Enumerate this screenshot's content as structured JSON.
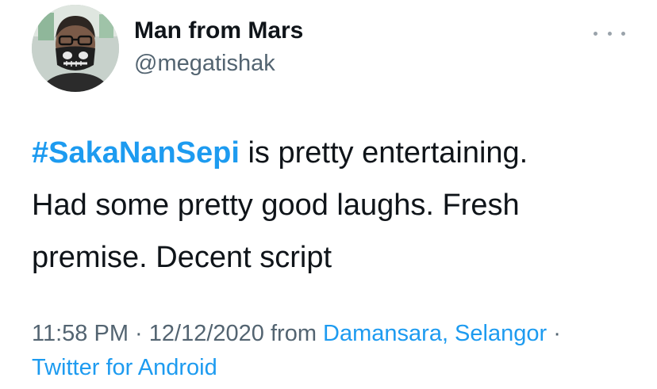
{
  "author": {
    "display_name": "Man from Mars",
    "handle": "@megatishak"
  },
  "icons": {
    "avatar": "profile-photo-skull-mask",
    "more": "more-horizontal-icon"
  },
  "tweet": {
    "hashtag": "#SakaNanSepi",
    "text_line1_rest": " is pretty entertaining.",
    "text_line2": "Had some pretty good laughs. Fresh",
    "text_line3": "premise. Decent script"
  },
  "meta": {
    "time": "11:58 PM",
    "separator": " · ",
    "date": "12/12/2020",
    "from_label": " from ",
    "location": "Damansara, Selangor",
    "separator2": " ·",
    "source": "Twitter for Android"
  },
  "colors": {
    "link": "#1d9bf0",
    "text": "#0f1419",
    "secondary": "#536471"
  }
}
